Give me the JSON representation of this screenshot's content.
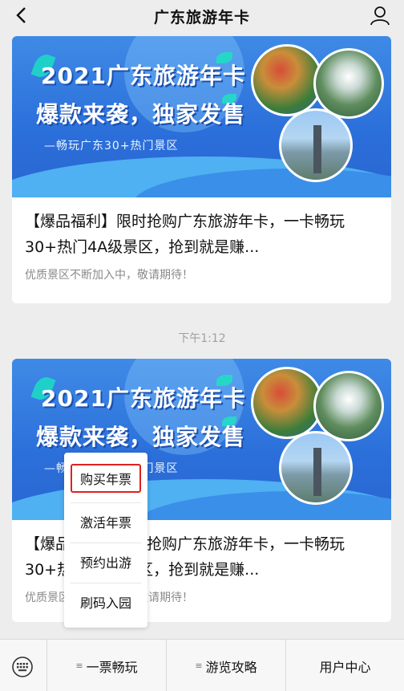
{
  "header": {
    "title": "广东旅游年卡",
    "back_icon": "back-arrow-icon",
    "profile_icon": "user-icon"
  },
  "messages": [
    {
      "banner": {
        "headline1": "2021广东旅游年卡",
        "headline2": "爆款来袭，独家发售",
        "subline": "—畅玩广东30+热门景区"
      },
      "title": "【爆品福利】限时抢购广东旅游年卡，一卡畅玩30+热门4A级景区，抢到就是赚...",
      "desc": "优质景区不断加入中，敬请期待！"
    },
    {
      "banner": {
        "headline1": "2021广东旅游年卡",
        "headline2": "爆款来袭，独家发售",
        "subline": "—畅玩广东30+热门景区"
      },
      "title": "【爆品福利】限时抢购广东旅游年卡，一卡畅玩30+热门4A级景区，抢到就是赚...",
      "title_visible": "【爆            限时抢购广东旅游年卡，一卡畅            4A级景区，抢到就是赚...",
      "desc": "优质景区不断加入中，敬请期待！"
    }
  ],
  "timestamp": "下午1:12",
  "popup_menu": {
    "items": [
      {
        "label": "购买年票",
        "selected": true
      },
      {
        "label": "激活年票",
        "selected": false
      },
      {
        "label": "预约出游",
        "selected": false
      },
      {
        "label": "刷码入园",
        "selected": false
      }
    ]
  },
  "bottom_bar": {
    "keyboard_icon": "keyboard-icon",
    "menus": [
      {
        "label": "一票畅玩",
        "has_submenu": true
      },
      {
        "label": "游览攻略",
        "has_submenu": true
      },
      {
        "label": "用户中心",
        "has_submenu": false
      }
    ]
  },
  "colors": {
    "background": "#ededed",
    "card": "#ffffff",
    "banner_blue": "#2b6fda",
    "highlight_red": "#e02020"
  }
}
